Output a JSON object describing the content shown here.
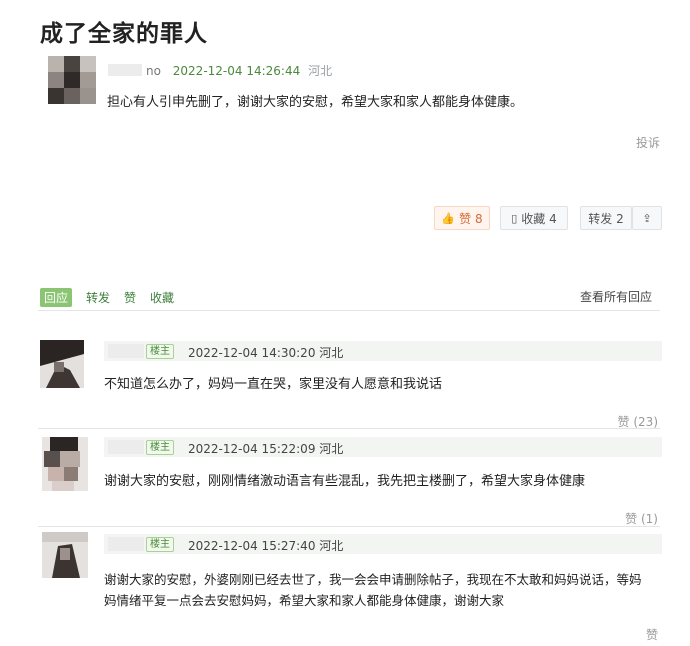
{
  "post": {
    "title": "成了全家的罪人",
    "author_suffix": "no",
    "date": "2022-12-04 14:26:44",
    "location": "河北",
    "content": "担心有人引申先删了，谢谢大家的安慰，希望大家和家人都能身体健康。",
    "report": "投诉",
    "actions": {
      "like": "赞 8",
      "collect": "收藏 4",
      "forward": "转发 2"
    }
  },
  "tabs": {
    "reply": "回应",
    "forward": "转发",
    "like": "赞",
    "collect": "收藏",
    "view_all": "查看所有回应"
  },
  "replies": [
    {
      "badge": "楼主",
      "date": "2022-12-04 14:30:20 河北",
      "content": "不知道怎么办了，妈妈一直在哭，家里没有人愿意和我说话",
      "likes": "赞 (23)"
    },
    {
      "badge": "楼主",
      "date": "2022-12-04 15:22:09 河北",
      "content": "谢谢大家的安慰，刚刚情绪激动语言有些混乱，我先把主楼删了，希望大家身体健康",
      "likes": "赞 (1)"
    },
    {
      "badge": "楼主",
      "date": "2022-12-04 15:27:40 河北",
      "content_line1": "谢谢大家的安慰，外婆刚刚已经去世了，我一会会申请删除帖子，我现在不太敢和妈妈说话，等妈",
      "content_line2": "妈情绪平复一点会去安慰妈妈，希望大家和家人都能身体健康，谢谢大家",
      "likes": "赞"
    }
  ]
}
